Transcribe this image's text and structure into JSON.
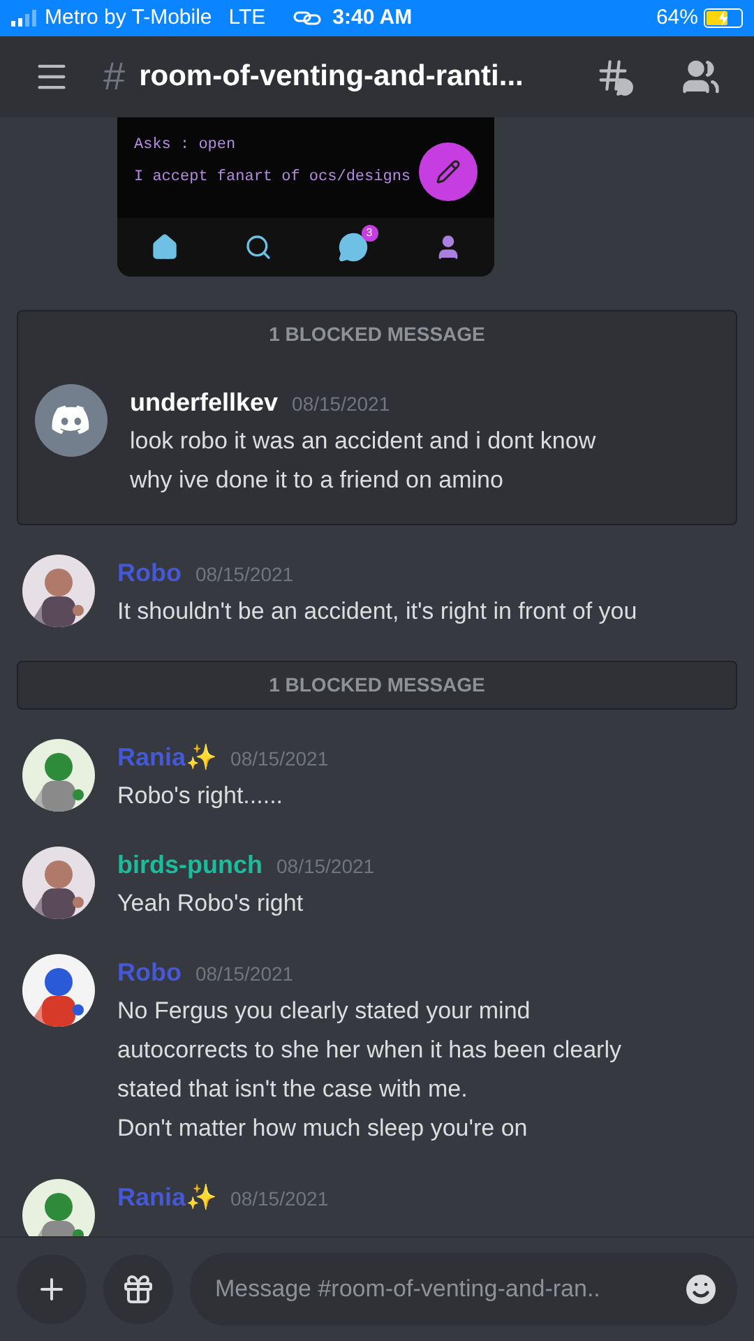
{
  "status_bar": {
    "carrier": "Metro by T-Mobile",
    "network": "LTE",
    "time": "3:40 AM",
    "battery": "64%",
    "charging": true
  },
  "header": {
    "hash": "#",
    "channel": "room-of-venting-and-ranti..."
  },
  "embed": {
    "lines": [
      "Asks : open",
      "I accept fanart of ocs/designs"
    ],
    "nav_badge": "3"
  },
  "feed": [
    {
      "kind": "blocked",
      "label": "1 BLOCKED MESSAGE",
      "messages": [
        {
          "author": "underfellkev",
          "color": "#ffffff",
          "avatar": {
            "kind": "default"
          },
          "time": "08/15/2021",
          "lines": [
            "look robo it was an accident and i dont know",
            "why ive done it to a friend on amino"
          ]
        }
      ]
    },
    {
      "kind": "message",
      "author": "Robo",
      "color": "#4458d8",
      "avatar": {
        "kind": "picture"
      },
      "time": "08/15/2021",
      "lines": [
        "It shouldn't be an accident, it's right in front of you"
      ]
    },
    {
      "kind": "blocked",
      "label": "1 BLOCKED MESSAGE"
    },
    {
      "kind": "message",
      "author": "Rania✨",
      "color": "#4458d8",
      "avatar": {
        "kind": "picture"
      },
      "time": "08/15/2021",
      "lines": [
        "Robo's right......"
      ]
    },
    {
      "kind": "message",
      "author": "birds-punch",
      "color": "#1abc9c",
      "avatar": {
        "kind": "picture"
      },
      "time": "08/15/2021",
      "lines": [
        "Yeah Robo's right"
      ]
    },
    {
      "kind": "message",
      "author": "Robo",
      "color": "#4458d8",
      "avatar": {
        "kind": "picture"
      },
      "time": "08/15/2021",
      "lines": [
        "No Fergus you clearly stated your mind",
        "autocorrects to she her when it has been clearly",
        "stated that isn't the case with me.",
        "Don't matter how much sleep you're on"
      ]
    },
    {
      "kind": "message",
      "author": "Rania✨",
      "color": "#4458d8",
      "avatar": {
        "kind": "picture"
      },
      "time": "08/15/2021"
    }
  ],
  "composer": {
    "placeholder": "Message #room-of-venting-and-ran.."
  }
}
